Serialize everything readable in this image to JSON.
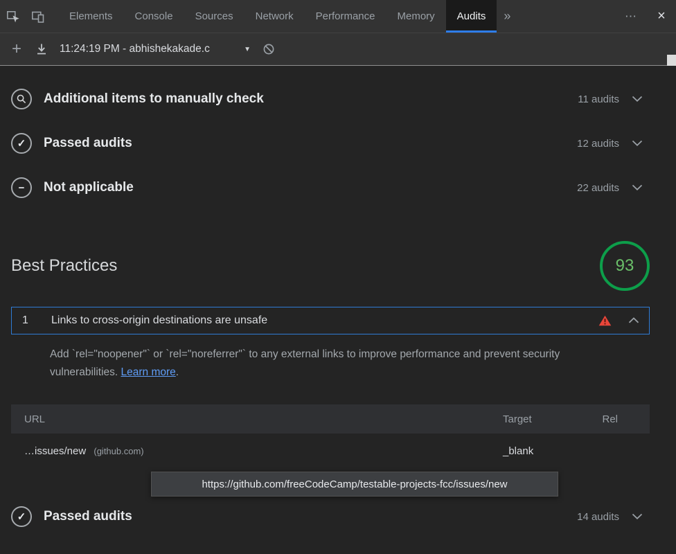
{
  "window": {
    "tabs": [
      {
        "label": "Elements"
      },
      {
        "label": "Console"
      },
      {
        "label": "Sources"
      },
      {
        "label": "Network"
      },
      {
        "label": "Performance"
      },
      {
        "label": "Memory"
      },
      {
        "label": "Audits"
      }
    ],
    "active_tab": "Audits",
    "icons": {
      "overflow": "»",
      "more": "⋯",
      "close": "×"
    }
  },
  "toolbar": {
    "add": "+",
    "report_selector": "11:24:19 PM - abhishekakade.c",
    "dropdown_arrow": "▼"
  },
  "sections": [
    {
      "title": "Additional items to manually check",
      "count": "11 audits"
    },
    {
      "title": "Passed audits",
      "count": "12 audits"
    },
    {
      "title": "Not applicable",
      "count": "22 audits"
    }
  ],
  "icons": {
    "check": "✓",
    "minus": "−"
  },
  "category": {
    "title": "Best Practices",
    "score": "93",
    "score_color": "#0d9e4a"
  },
  "audit": {
    "index": "1",
    "title": "Links to cross-origin destinations are unsafe",
    "description": "Add `rel=\"noopener\"` or `rel=\"noreferrer\"` to any external links to improve performance and prevent security vulnerabilities. ",
    "learn_more": "Learn more",
    "description_suffix": "."
  },
  "table": {
    "headers": [
      "URL",
      "Target",
      "Rel"
    ],
    "row": {
      "url": "…issues/new",
      "url_note": "(github.com)",
      "target": "_blank",
      "rel": ""
    }
  },
  "tooltip": {
    "url": "https://github.com/freeCodeCamp/testable-projects-fcc/issues/new"
  },
  "footer_section": {
    "title": "Passed audits",
    "count": "14 audits"
  },
  "colors": {
    "active_tab_underline": "#2e7de9",
    "selected_audit_border": "#2f7cd6",
    "warning_red": "#e8463a",
    "link_blue": "#5f9cf5"
  }
}
